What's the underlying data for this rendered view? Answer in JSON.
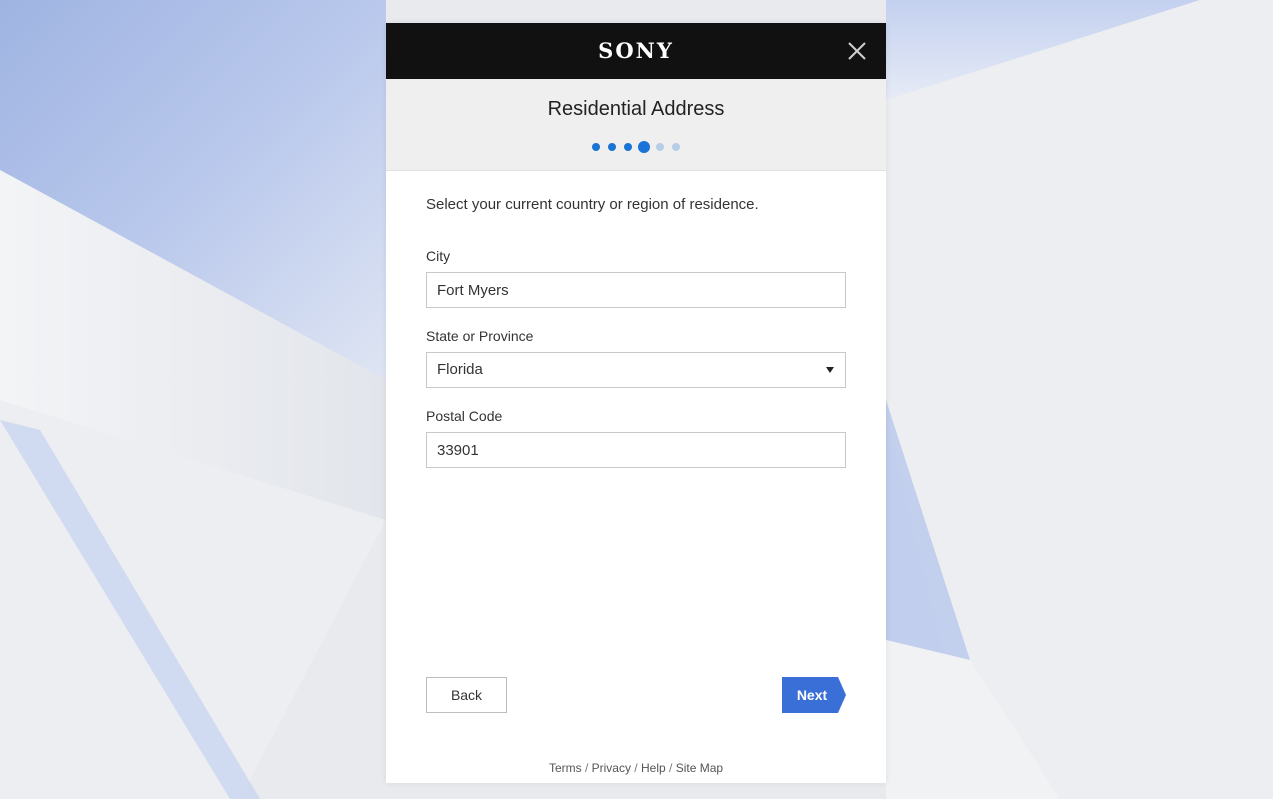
{
  "header": {
    "logo_text": "SONY",
    "close_icon": "close-icon",
    "title": "Residential Address",
    "steps": [
      "complete",
      "complete",
      "complete",
      "current",
      "pending",
      "pending"
    ]
  },
  "form": {
    "instruction": "Select your current country or region of residence.",
    "city": {
      "label": "City",
      "value": "Fort Myers"
    },
    "state": {
      "label": "State or Province",
      "value": "Florida",
      "icon": "dropdown-caret-icon"
    },
    "postal": {
      "label": "Postal Code",
      "value": "33901"
    }
  },
  "buttons": {
    "back_label": "Back",
    "next_label": "Next"
  },
  "footer": {
    "terms": "Terms",
    "privacy": "Privacy",
    "help": "Help",
    "sitemap": "Site Map",
    "separator": " / "
  },
  "colors": {
    "topbar": "#111111",
    "accent": "#1a73d6",
    "next_button": "#3b6fd8",
    "step_pending": "#b7cde6"
  }
}
